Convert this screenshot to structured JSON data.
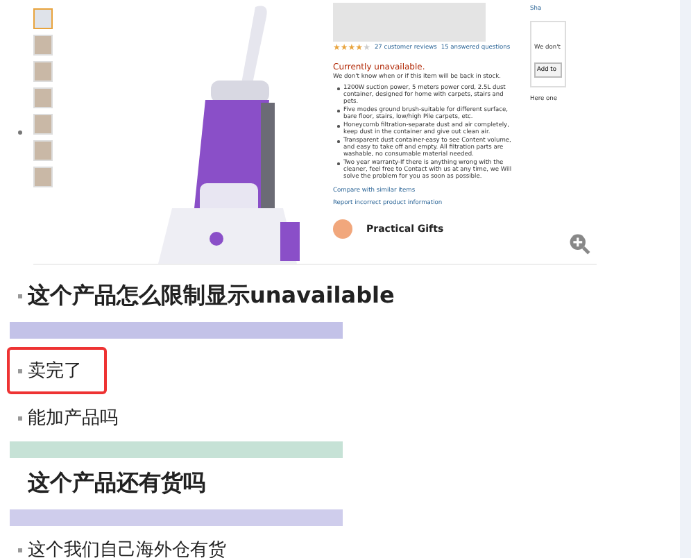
{
  "embedded_screenshot": {
    "thumbnails": [
      {
        "selected": true
      },
      {
        "selected": false
      },
      {
        "selected": false
      },
      {
        "selected": false
      },
      {
        "selected": false
      },
      {
        "selected": false
      },
      {
        "selected": false
      }
    ],
    "rating": {
      "stars": 4
    },
    "reviews_link": "27 customer reviews",
    "questions_link": "15 answered questions",
    "availability": "Currently unavailable.",
    "stock_note": "We don't know when or if this item will be back in stock.",
    "features": [
      "1200W suction power, 5 meters power cord, 2.5L dust container, designed for home with carpets, stairs and pets.",
      "Five modes ground brush-suitable for different surface, bare floor, stairs, low/high Pile carpets, etc.",
      "Honeycomb filtration-separate dust and air completely, keep dust in the container and give out clean air.",
      "Transparent dust container-easy to see Content volume, and easy to take off and empty. All filtration parts are washable, no consumable material needed.",
      "Two year warranty-If there is anything wrong with the cleaner, feel free to Contact with us at any time, we Will solve the problem for you as soon as possible."
    ],
    "compare_link": "Compare with similar items",
    "report_link": "Report incorrect product information",
    "promo_title": "Practical Gifts",
    "side_link": "Sha",
    "buy_box_note": "We don't",
    "add_button": "Add to",
    "side_note": "Here one"
  },
  "posts": [
    {
      "kind": "heading",
      "text": "这个产品怎么限制显示unavailable",
      "bullet": true,
      "highlighted": false
    },
    {
      "kind": "redacted",
      "color": "#c3c2e8"
    },
    {
      "kind": "reply",
      "text": "卖完了",
      "bullet": true,
      "highlighted": true
    },
    {
      "kind": "reply",
      "text": "能加产品吗",
      "bullet": true,
      "highlighted": false
    },
    {
      "kind": "redacted",
      "color": "#c6e2d6"
    },
    {
      "kind": "heading",
      "text": "这个产品还有货吗",
      "bullet": false,
      "highlighted": false
    },
    {
      "kind": "redacted",
      "color": "#cfcdec"
    },
    {
      "kind": "reply",
      "text": "这个我们自己海外仓有货",
      "bullet": true,
      "highlighted": false
    }
  ]
}
